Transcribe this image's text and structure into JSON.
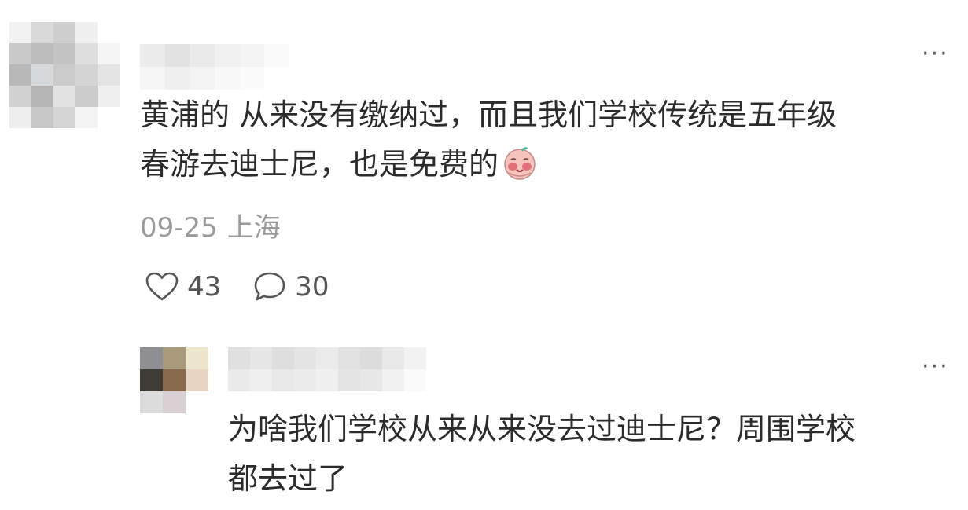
{
  "comment": {
    "text_line1": "黄浦的 从来没有缴纳过，而且我们学校传统是五年级",
    "text_line2": "春游去迪士尼，也是免费的",
    "emoji": "blushing-face-emoji",
    "date": "09-25",
    "location": "上海",
    "likes": "43",
    "replies": "30",
    "more_icon": "more-dots-icon"
  },
  "reply": {
    "text_line1": "为啥我们学校从来从来没去过迪士尼？周围学校",
    "text_line2": "都去过了",
    "more_icon": "more-dots-icon"
  },
  "icons": {
    "like": "heart-icon",
    "reply": "speech-bubble-icon"
  },
  "colors": {
    "text": "#2b2b2b",
    "meta": "#9b9b9b",
    "icon": "#555555"
  }
}
